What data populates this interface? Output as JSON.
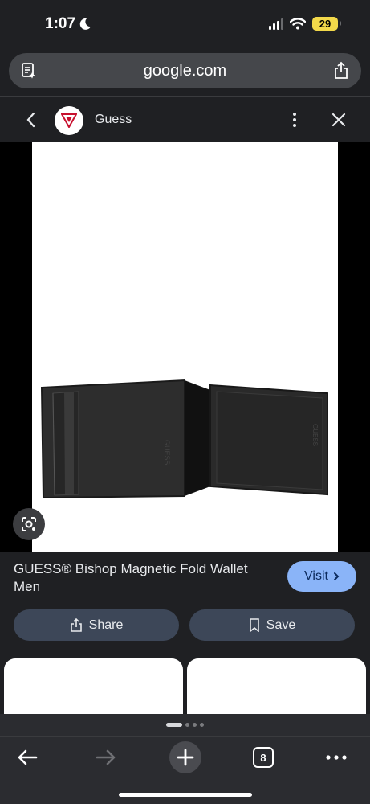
{
  "status_bar": {
    "time": "1:07",
    "battery": "29"
  },
  "address_bar": {
    "url": "google.com"
  },
  "source": {
    "name": "Guess"
  },
  "product": {
    "title": "GUESS® Bishop Magnetic Fold Wallet Men",
    "visit_label": "Visit"
  },
  "actions": {
    "share_label": "Share",
    "save_label": "Save"
  },
  "toolbar": {
    "tab_count": "8"
  },
  "colors": {
    "accent": "#8ab4f8",
    "pill": "#3d4758",
    "background": "#1f2023"
  }
}
